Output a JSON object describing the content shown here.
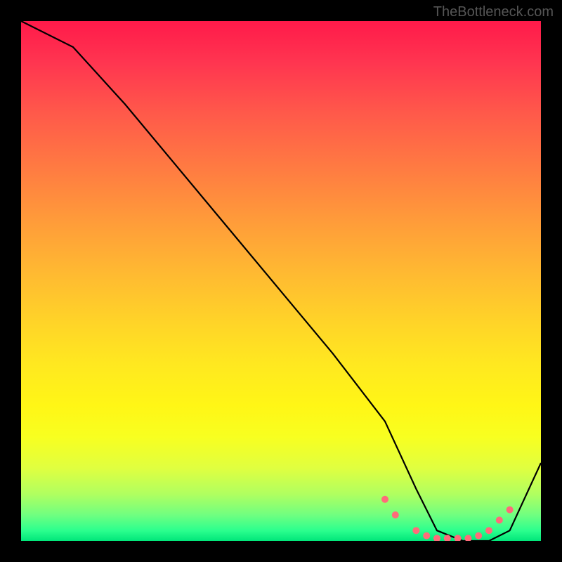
{
  "watermark": "TheBottleneck.com",
  "chart_data": {
    "type": "line",
    "title": "",
    "xlabel": "",
    "ylabel": "",
    "xlim": [
      0,
      100
    ],
    "ylim": [
      0,
      100
    ],
    "series": [
      {
        "name": "curve",
        "x": [
          0,
          10,
          20,
          30,
          40,
          50,
          60,
          70,
          76,
          80,
          85,
          90,
          94,
          100
        ],
        "values": [
          100,
          95,
          84,
          72,
          60,
          48,
          36,
          23,
          10,
          2,
          0,
          0,
          2,
          15
        ]
      }
    ],
    "markers": {
      "name": "points",
      "x": [
        70,
        72,
        76,
        78,
        80,
        82,
        84,
        86,
        88,
        90,
        92,
        94
      ],
      "values": [
        8,
        5,
        2,
        1,
        0.5,
        0.5,
        0.5,
        0.5,
        1,
        2,
        4,
        6
      ]
    },
    "gradient_stops": [
      {
        "pos": 0,
        "color": "#ff1a4a"
      },
      {
        "pos": 50,
        "color": "#ffd428"
      },
      {
        "pos": 80,
        "color": "#fff616"
      },
      {
        "pos": 100,
        "color": "#00e67a"
      }
    ]
  }
}
